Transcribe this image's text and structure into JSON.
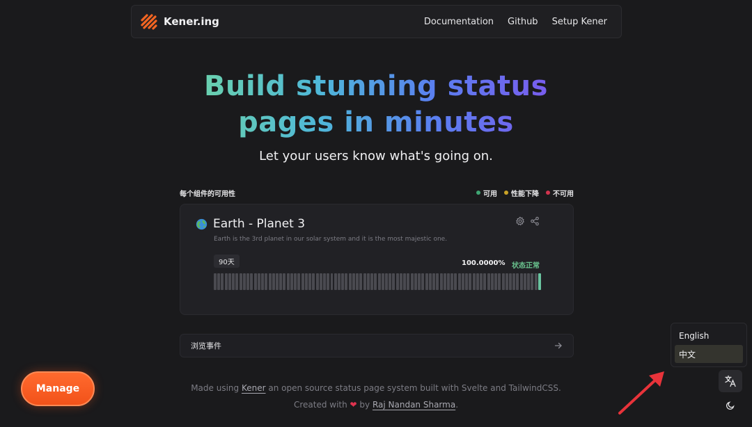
{
  "header": {
    "brand": "Kener.ing",
    "nav": [
      "Documentation",
      "Github",
      "Setup Kener"
    ]
  },
  "hero": {
    "title": "Build stunning status pages in minutes",
    "subtitle": "Let your users know what's going on."
  },
  "section": {
    "title": "每个组件的可用性",
    "legend": [
      {
        "label": "可用",
        "color": "#3fa673"
      },
      {
        "label": "性能下降",
        "color": "#c9a227"
      },
      {
        "label": "不可用",
        "color": "#d2344e"
      }
    ]
  },
  "monitor": {
    "name": "Earth - Planet 3",
    "description": "Earth is the 3rd planet in our solar system and it is the most majestic one.",
    "range": "90天",
    "uptime": "100.0000%",
    "status": "状态正常",
    "bar_count": 90,
    "bar_color": "#4a4a50",
    "last_bar_color": "#6ac4a0"
  },
  "incidents": {
    "label": "浏览事件"
  },
  "footer": {
    "line1_prefix": "Made using ",
    "line1_link": "Kener",
    "line1_suffix": " an open source status page system built with Svelte and TailwindCSS.",
    "line2_prefix": "Created with ",
    "line2_by": " by ",
    "line2_author": "Raj Nandan Sharma",
    "line2_end": "."
  },
  "manage_button": "Manage",
  "language_menu": {
    "options": [
      "English",
      "中文"
    ],
    "selected": "中文"
  },
  "icons": {
    "logo": "kener-logo-icon",
    "globe": "globe-icon",
    "settings": "gear-icon",
    "share": "share-icon",
    "arrow": "arrow-right-icon",
    "translate": "translate-icon",
    "theme": "moon-icon",
    "heart": "heart-icon"
  },
  "colors": {
    "accent_orange": "#f2521a",
    "annotation_red": "#e8333a"
  }
}
